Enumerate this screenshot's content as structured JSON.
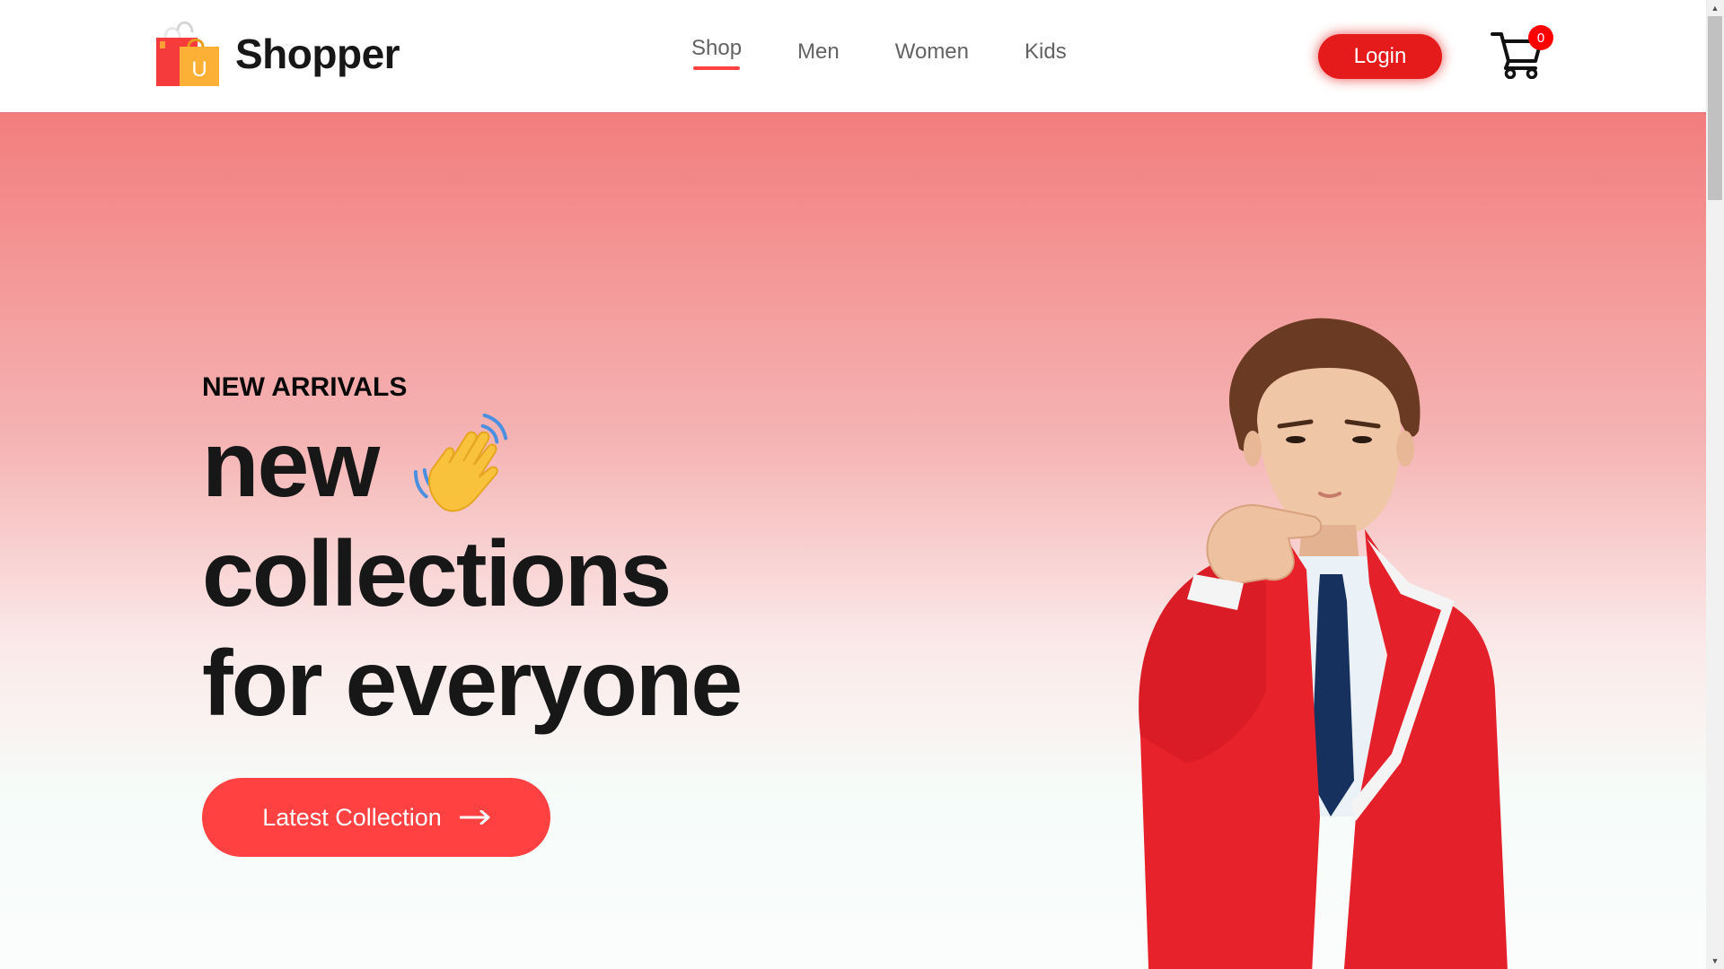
{
  "brand": {
    "name": "Shopper",
    "logo_icon": "shopping-bags-icon",
    "logo_letter": "U"
  },
  "nav": {
    "items": [
      {
        "label": "Shop",
        "active": true
      },
      {
        "label": "Men",
        "active": false
      },
      {
        "label": "Women",
        "active": false
      },
      {
        "label": "Kids",
        "active": false
      }
    ]
  },
  "header": {
    "login_label": "Login",
    "cart_icon": "cart-icon",
    "cart_count": "0"
  },
  "hero": {
    "subtitle": "NEW ARRIVALS",
    "line1": "new",
    "line2": "collections",
    "line3": "for everyone",
    "hand_icon": "waving-hand-icon",
    "button_label": "Latest Collection",
    "button_icon": "arrow-right-icon",
    "image": "model-in-red-blazer-pointing"
  },
  "colors": {
    "accent": "#ff4141",
    "login": "#e51b1b",
    "text_dark": "#171717",
    "nav_text": "#626262",
    "hero_top": "#f37d7d",
    "hero_bottom": "#fbfdfc"
  }
}
